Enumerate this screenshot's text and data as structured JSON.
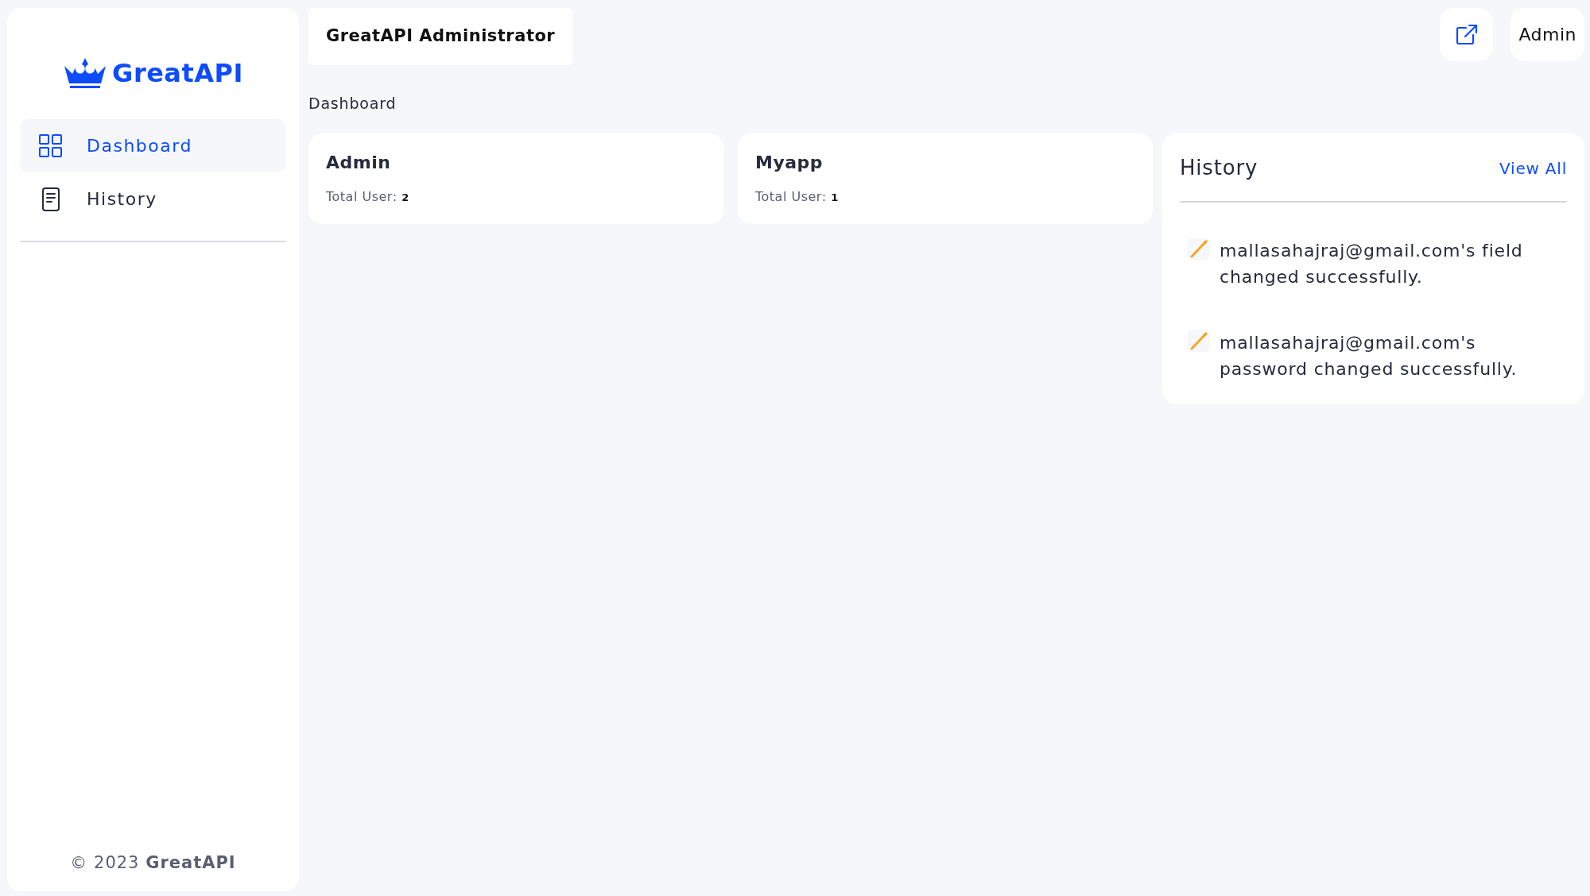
{
  "sidebar": {
    "brand": "GreatAPI",
    "items": [
      {
        "label": "Dashboard",
        "kind": "grid",
        "selected": true
      },
      {
        "label": "History",
        "kind": "document",
        "selected": false
      }
    ],
    "footer": "© 2023 **GreatAPI**"
  },
  "header": {
    "title": "GreatAPI Administrator",
    "user": "Admin"
  },
  "breadcrumb": "Dashboard",
  "stats": [
    {
      "title": "Admin",
      "text": "Total User: **2**"
    },
    {
      "title": "Myapp",
      "text": "Total User: **1**"
    }
  ],
  "history": {
    "title": "History",
    "link": "View All",
    "items": [
      {
        "text": "mallasahajraj@gmail.com's field changed successfully."
      },
      {
        "text": "mallasahajraj@gmail.com's password changed successfully."
      }
    ]
  }
}
